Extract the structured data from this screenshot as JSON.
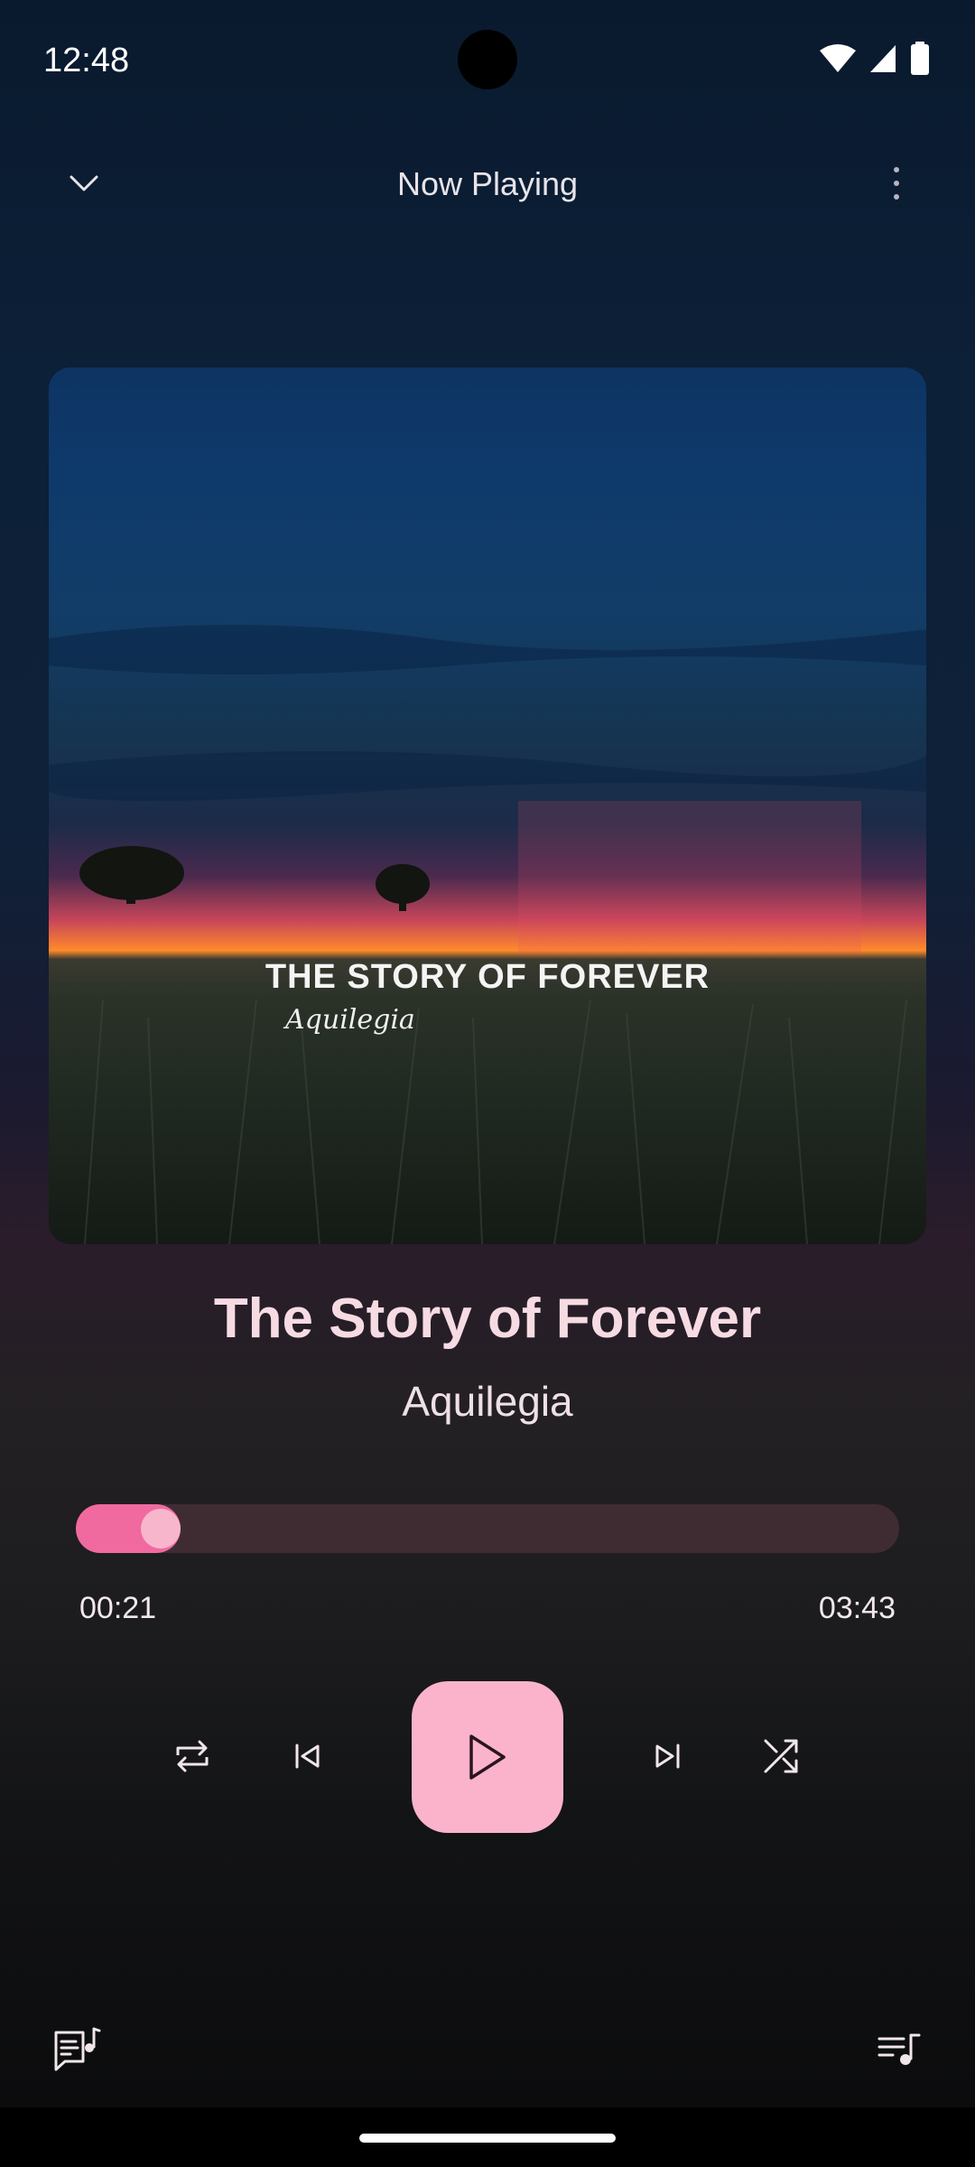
{
  "status_bar": {
    "time": "12:48"
  },
  "header": {
    "title": "Now Playing"
  },
  "album_art": {
    "title_text": "THE STORY OF FOREVER",
    "artist_text": "Aquilegia"
  },
  "track": {
    "title": "The Story of Forever",
    "artist": "Aquilegia"
  },
  "progress": {
    "elapsed": "00:21",
    "total": "03:43",
    "fraction": 0.094
  },
  "controls": {
    "repeat": "repeat-icon",
    "previous": "skip-previous-icon",
    "play": "play-icon",
    "next": "skip-next-icon",
    "shuffle": "shuffle-icon"
  },
  "bottom": {
    "lyrics": "lyrics-icon",
    "queue": "queue-icon"
  },
  "colors": {
    "accent": "#f06aa0",
    "play_button": "#fbb3cb",
    "thumb": "#f7b6cb",
    "track_bg": "#3f2c33"
  }
}
